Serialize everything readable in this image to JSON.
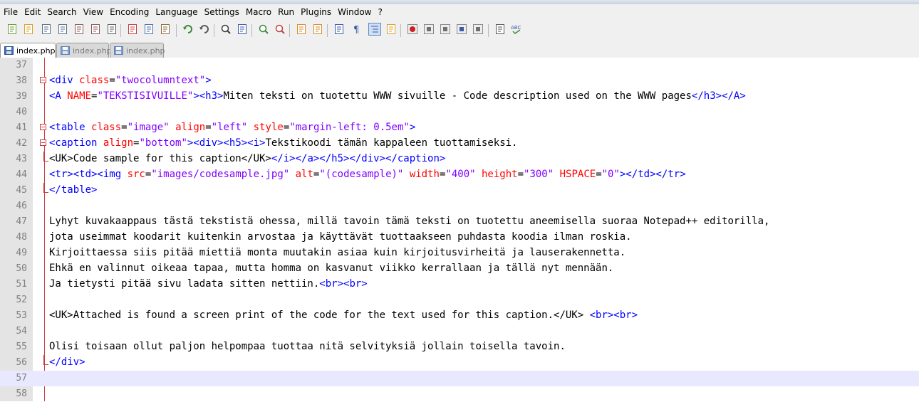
{
  "menu": [
    "File",
    "Edit",
    "Search",
    "View",
    "Encoding",
    "Language",
    "Settings",
    "Macro",
    "Run",
    "Plugins",
    "Window",
    "?"
  ],
  "toolbar_icons": [
    "new-file-icon",
    "open-file-icon",
    "save-icon",
    "save-all-icon",
    "close-icon",
    "close-all-icon",
    "print-icon",
    "cut-icon",
    "copy-icon",
    "paste-icon",
    "undo-icon",
    "redo-icon",
    "find-icon",
    "replace-icon",
    "zoom-in-icon",
    "zoom-out-icon",
    "sync-vertical-icon",
    "sync-horizontal-icon",
    "word-wrap-icon",
    "show-all-chars-icon",
    "indent-guide-icon",
    "doc-map-icon",
    "record-macro-icon",
    "stop-macro-icon",
    "play-macro-icon",
    "run-macro-multiple-icon",
    "save-macro-icon",
    "monitor-icon",
    "spellcheck-icon"
  ],
  "tabs": [
    {
      "label": "index.php",
      "active": true
    },
    {
      "label": "index.php",
      "active": false
    },
    {
      "label": "index.php",
      "active": false
    }
  ],
  "editor": {
    "current_line": 57,
    "lines": [
      {
        "num": "37",
        "fold": "",
        "segs": []
      },
      {
        "num": "38",
        "fold": "open",
        "segs": [
          {
            "c": "t",
            "s": "<div "
          },
          {
            "c": "a",
            "s": "class"
          },
          {
            "c": "x",
            "s": "="
          },
          {
            "c": "v",
            "s": "\"twocolumntext\""
          },
          {
            "c": "t",
            "s": ">"
          }
        ]
      },
      {
        "num": "39",
        "fold": "",
        "segs": [
          {
            "c": "t",
            "s": "<A "
          },
          {
            "c": "a",
            "s": "NAME"
          },
          {
            "c": "x",
            "s": "="
          },
          {
            "c": "v",
            "s": "\"TEKSTISIVUILLE\""
          },
          {
            "c": "t",
            "s": "><h3>"
          },
          {
            "c": "x",
            "s": "Miten teksti on tuotettu WWW sivuille - Code description used on the WWW pages"
          },
          {
            "c": "t",
            "s": "</h3></A>"
          }
        ]
      },
      {
        "num": "40",
        "fold": "",
        "segs": []
      },
      {
        "num": "41",
        "fold": "open",
        "segs": [
          {
            "c": "t",
            "s": "<table "
          },
          {
            "c": "a",
            "s": "class"
          },
          {
            "c": "x",
            "s": "="
          },
          {
            "c": "v",
            "s": "\"image\""
          },
          {
            "c": "x",
            "s": " "
          },
          {
            "c": "a",
            "s": "align"
          },
          {
            "c": "x",
            "s": "="
          },
          {
            "c": "v",
            "s": "\"left\""
          },
          {
            "c": "x",
            "s": " "
          },
          {
            "c": "a",
            "s": "style"
          },
          {
            "c": "x",
            "s": "="
          },
          {
            "c": "v",
            "s": "\"margin-left: 0.5em\""
          },
          {
            "c": "t",
            "s": ">"
          }
        ]
      },
      {
        "num": "42",
        "fold": "open",
        "segs": [
          {
            "c": "t",
            "s": "<caption "
          },
          {
            "c": "a",
            "s": "align"
          },
          {
            "c": "x",
            "s": "="
          },
          {
            "c": "v",
            "s": "\"bottom\""
          },
          {
            "c": "t",
            "s": "><div><h5><i>"
          },
          {
            "c": "x",
            "s": "Tekstikoodi tämän kappaleen tuottamiseksi."
          }
        ]
      },
      {
        "num": "43",
        "fold": "end",
        "segs": [
          {
            "c": "x",
            "s": "<UK>Code sample for this caption</UK>"
          },
          {
            "c": "t",
            "s": "</i></a></h5></div></caption>"
          }
        ]
      },
      {
        "num": "44",
        "fold": "",
        "segs": [
          {
            "c": "t",
            "s": "<tr><td><img "
          },
          {
            "c": "a",
            "s": "src"
          },
          {
            "c": "x",
            "s": "="
          },
          {
            "c": "v",
            "s": "\"images/codesample.jpg\""
          },
          {
            "c": "x",
            "s": " "
          },
          {
            "c": "a",
            "s": "alt"
          },
          {
            "c": "x",
            "s": "="
          },
          {
            "c": "v",
            "s": "\"(codesample)\""
          },
          {
            "c": "x",
            "s": " "
          },
          {
            "c": "a",
            "s": "width"
          },
          {
            "c": "x",
            "s": "="
          },
          {
            "c": "v",
            "s": "\"400\""
          },
          {
            "c": "x",
            "s": " "
          },
          {
            "c": "a",
            "s": "height"
          },
          {
            "c": "x",
            "s": "="
          },
          {
            "c": "v",
            "s": "\"300\""
          },
          {
            "c": "x",
            "s": " "
          },
          {
            "c": "a",
            "s": "HSPACE"
          },
          {
            "c": "x",
            "s": "="
          },
          {
            "c": "v",
            "s": "\"0\""
          },
          {
            "c": "t",
            "s": "></td></tr>"
          }
        ]
      },
      {
        "num": "45",
        "fold": "end",
        "segs": [
          {
            "c": "t",
            "s": "</table>"
          }
        ]
      },
      {
        "num": "46",
        "fold": "",
        "segs": []
      },
      {
        "num": "47",
        "fold": "",
        "segs": [
          {
            "c": "x",
            "s": "Lyhyt kuvakaappaus tästä tekstistä ohessa, millä tavoin tämä teksti on tuotettu aneemisella suoraa Notepad++ editorilla,"
          }
        ]
      },
      {
        "num": "48",
        "fold": "",
        "segs": [
          {
            "c": "x",
            "s": "jota useimmat koodarit kuitenkin arvostaa ja käyttävät tuottaakseen puhdasta koodia ilman roskia."
          }
        ]
      },
      {
        "num": "49",
        "fold": "",
        "segs": [
          {
            "c": "x",
            "s": "Kirjoittaessa siis pitää miettiä monta muutakin asiaa kuin kirjoitusvirheitä ja lauserakennetta."
          }
        ]
      },
      {
        "num": "50",
        "fold": "",
        "segs": [
          {
            "c": "x",
            "s": "Ehkä en valinnut oikeaa tapaa, mutta homma on kasvanut viikko kerrallaan ja tällä nyt mennään."
          }
        ]
      },
      {
        "num": "51",
        "fold": "",
        "segs": [
          {
            "c": "x",
            "s": "Ja tietysti pitää sivu ladata sitten nettiin."
          },
          {
            "c": "t",
            "s": "<br><br>"
          }
        ]
      },
      {
        "num": "52",
        "fold": "",
        "segs": []
      },
      {
        "num": "53",
        "fold": "",
        "segs": [
          {
            "c": "x",
            "s": "<UK>Attached is found a screen print of the code for the text used for this caption.</UK> "
          },
          {
            "c": "t",
            "s": "<br><br>"
          }
        ]
      },
      {
        "num": "54",
        "fold": "",
        "segs": []
      },
      {
        "num": "55",
        "fold": "",
        "segs": [
          {
            "c": "x",
            "s": "Olisi toisaan ollut paljon helpompaa tuottaa nitä selvityksiä jollain toisella tavoin."
          }
        ]
      },
      {
        "num": "56",
        "fold": "end",
        "segs": [
          {
            "c": "t",
            "s": "</div>"
          }
        ]
      },
      {
        "num": "57",
        "fold": "",
        "segs": []
      },
      {
        "num": "58",
        "fold": "",
        "segs": []
      }
    ]
  }
}
